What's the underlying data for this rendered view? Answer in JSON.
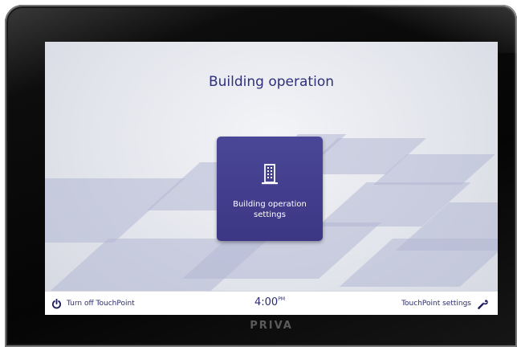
{
  "screen": {
    "title": "Building operation"
  },
  "main_tile": {
    "icon": "building-icon",
    "label": "Building operation settings"
  },
  "status_bar": {
    "power": {
      "icon": "power-icon",
      "label": "Turn off TouchPoint"
    },
    "clock": {
      "time": "4:00",
      "meridiem": "PM"
    },
    "settings": {
      "icon": "wrench-icon",
      "label": "TouchPoint settings"
    }
  },
  "device": {
    "brand": "PRIVA"
  },
  "colors": {
    "accent": "#3f3b8a",
    "text": "#2b2b6e",
    "screen_background": "#e3e5ec",
    "floor_tile": "#b2b8d4"
  }
}
